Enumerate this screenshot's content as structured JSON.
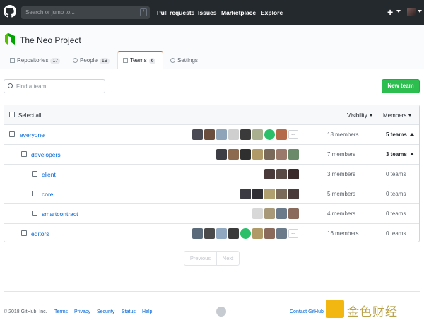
{
  "header": {
    "search_placeholder": "Search or jump to...",
    "slash_key": "/",
    "nav": [
      "Pull requests",
      "Issues",
      "Marketplace",
      "Explore"
    ],
    "plus": "+"
  },
  "org": {
    "name": "The Neo Project",
    "tabs": [
      {
        "label": "Repositories",
        "count": "17"
      },
      {
        "label": "People",
        "count": "19"
      },
      {
        "label": "Teams",
        "count": "6"
      },
      {
        "label": "Settings",
        "count": ""
      }
    ]
  },
  "toolbar": {
    "find_placeholder": "Find a team...",
    "new_team": "New team"
  },
  "table": {
    "select_all": "Select all",
    "visibility": "Visibility",
    "members": "Members",
    "rows": [
      {
        "name": "everyone",
        "members": "18 members",
        "teams": "5 teams",
        "expanded": true
      },
      {
        "name": "developers",
        "members": "7 members",
        "teams": "3 teams",
        "expanded": true
      },
      {
        "name": "client",
        "members": "3 members",
        "teams": "0 teams",
        "expanded": false
      },
      {
        "name": "core",
        "members": "5 members",
        "teams": "0 teams",
        "expanded": false
      },
      {
        "name": "smartcontract",
        "members": "4 members",
        "teams": "0 teams",
        "expanded": false
      },
      {
        "name": "editors",
        "members": "16 members",
        "teams": "0 teams",
        "expanded": false
      }
    ],
    "more": "..."
  },
  "pagination": {
    "previous": "Previous",
    "next": "Next"
  },
  "footer": {
    "copyright": "© 2018 GitHub, Inc.",
    "links": [
      "Terms",
      "Privacy",
      "Security",
      "Status",
      "Help"
    ],
    "contact": "Contact GitHub"
  },
  "watermark": "金色财经",
  "colors": {
    "accent": "#0366d6",
    "green": "#2cbe4e",
    "topbar": "#24292e",
    "tab_highlight": "#e36209"
  }
}
